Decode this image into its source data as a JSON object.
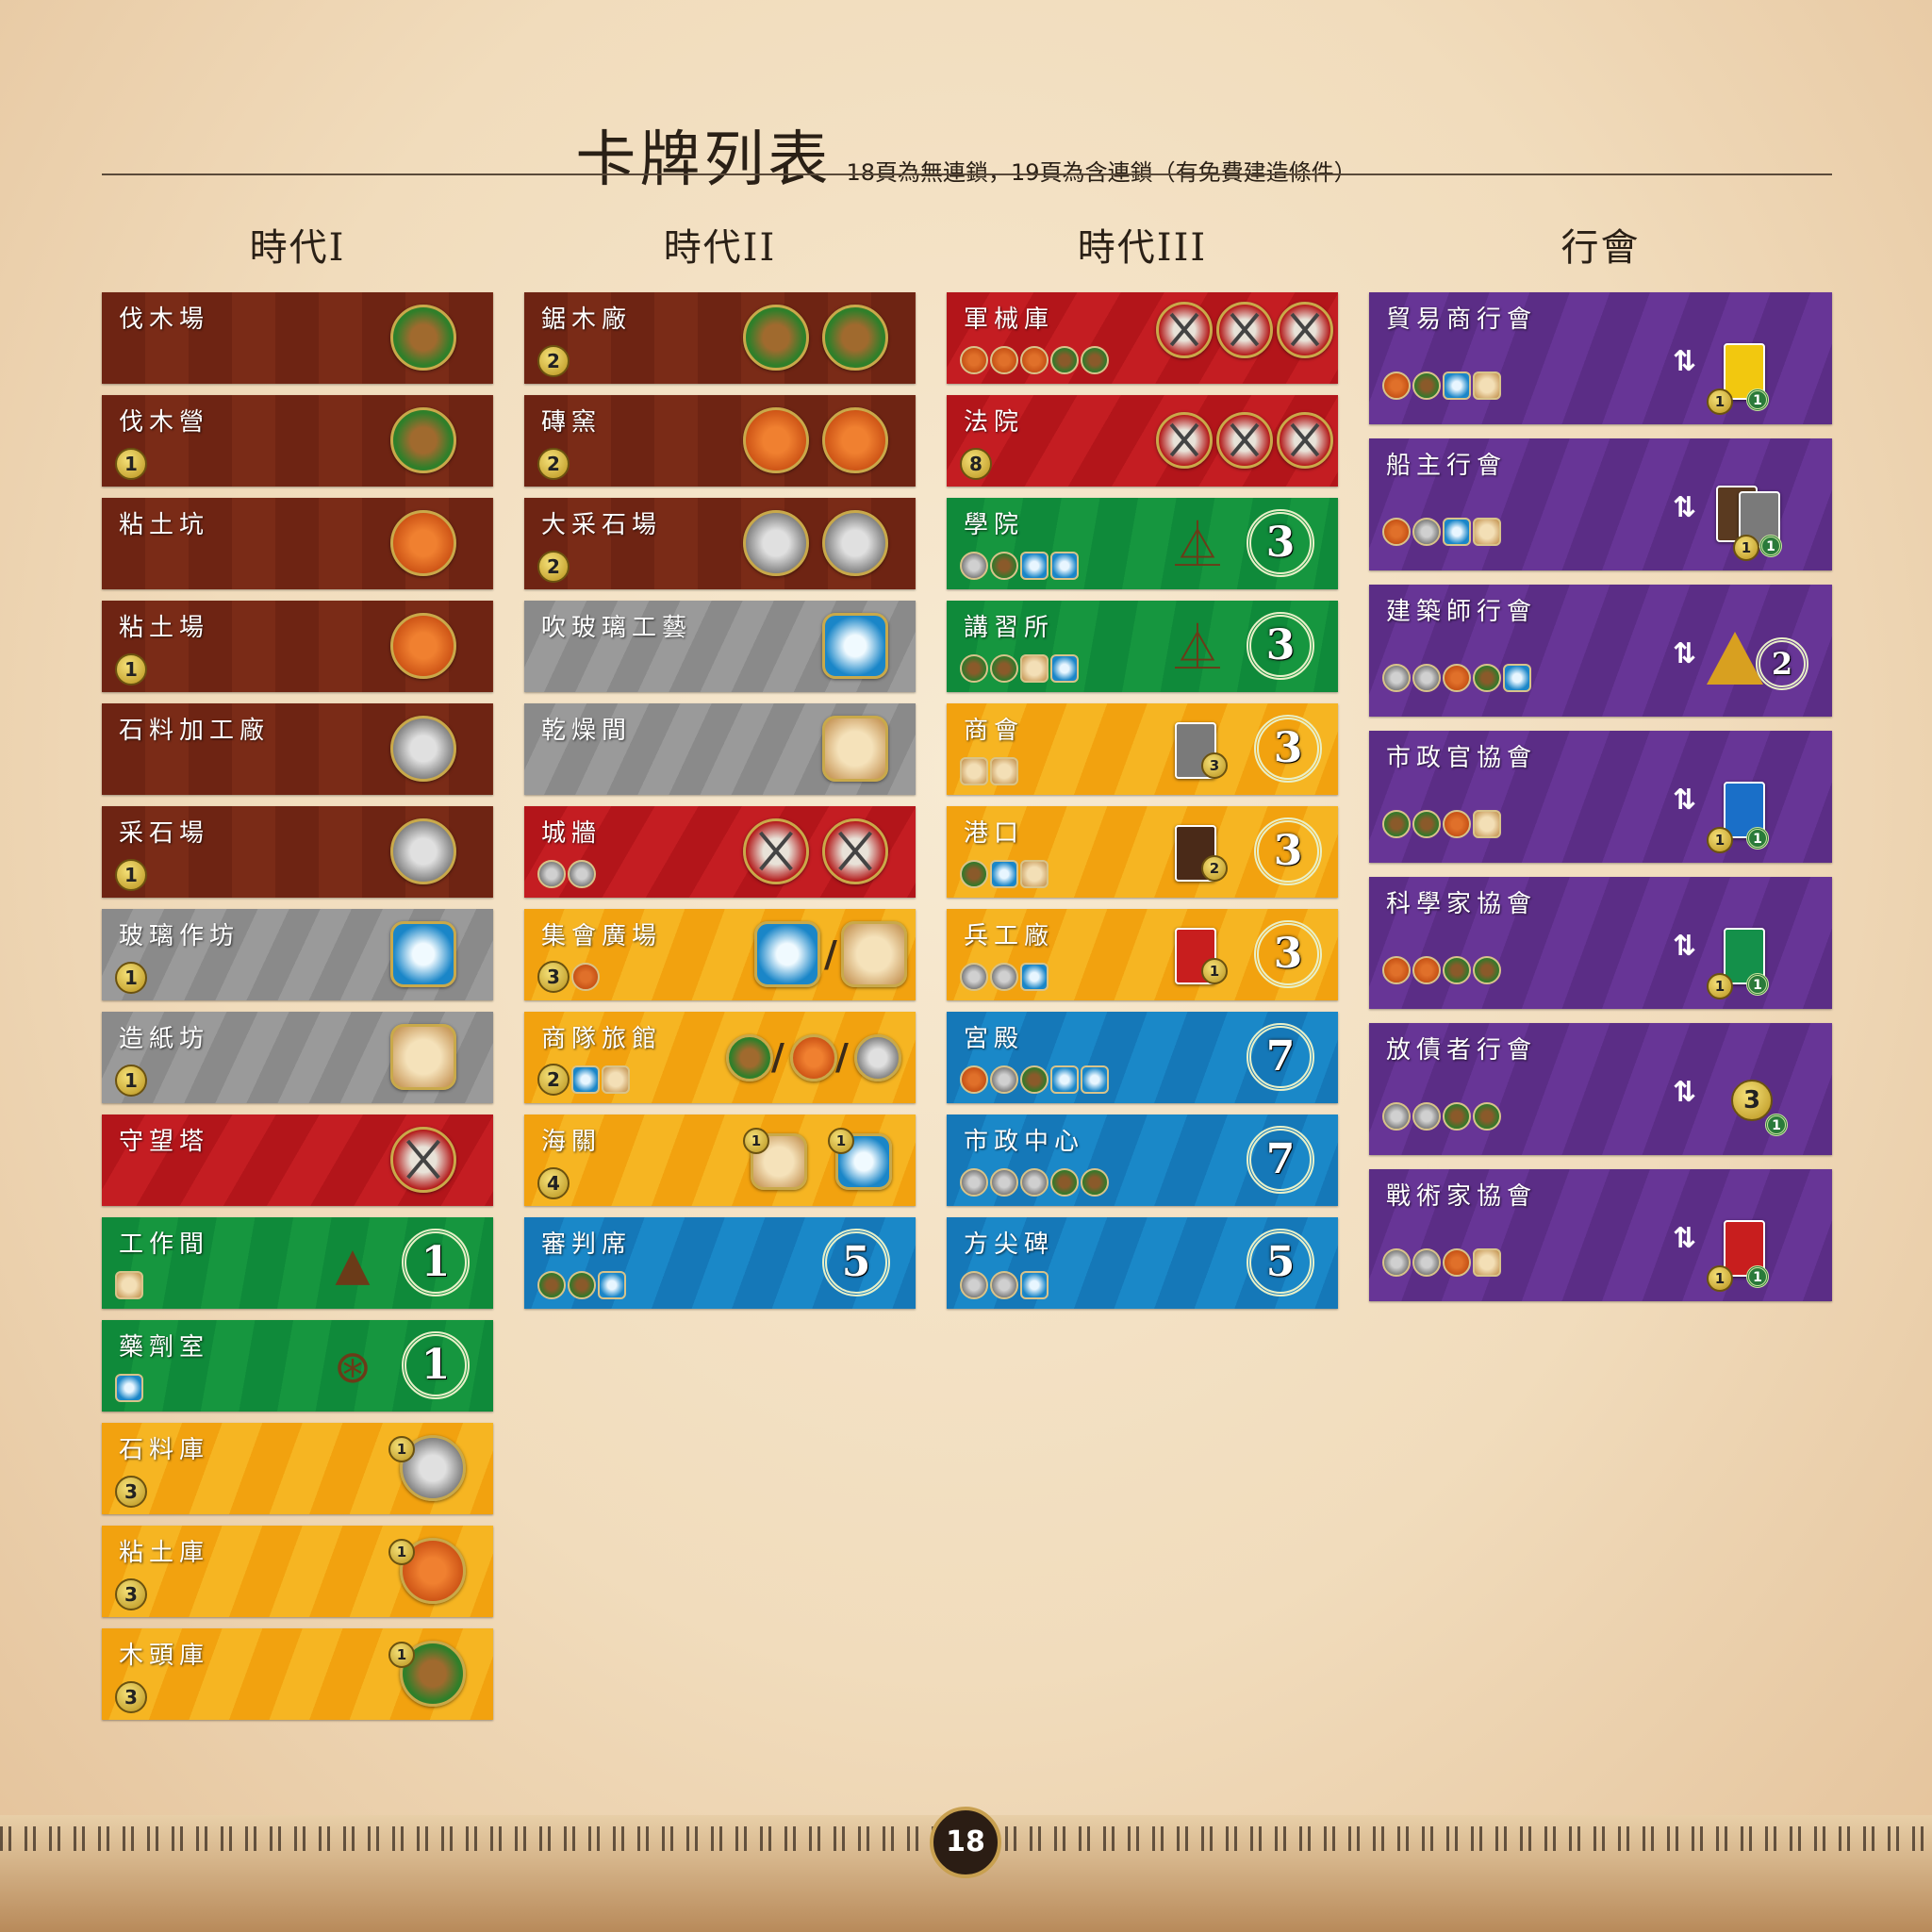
{
  "header": {
    "title": "卡牌列表",
    "subtitle": "18頁為無連鎖，19頁為含連鎖（有免費建造條件）"
  },
  "columns": {
    "age1": {
      "heading": "時代I",
      "cards": [
        {
          "name": "伐木場",
          "color": "brown",
          "cost": ""
        },
        {
          "name": "伐木營",
          "color": "brown",
          "cost": "1"
        },
        {
          "name": "粘土坑",
          "color": "brown",
          "cost": ""
        },
        {
          "name": "粘土場",
          "color": "brown",
          "cost": "1"
        },
        {
          "name": "石料加工廠",
          "color": "brown",
          "cost": ""
        },
        {
          "name": "采石場",
          "color": "brown",
          "cost": "1"
        },
        {
          "name": "玻璃作坊",
          "color": "gray",
          "cost": "1"
        },
        {
          "name": "造紙坊",
          "color": "gray",
          "cost": "1"
        },
        {
          "name": "守望塔",
          "color": "red",
          "cost": ""
        },
        {
          "name": "工作間",
          "color": "green",
          "cost": "",
          "points": "1"
        },
        {
          "name": "藥劑室",
          "color": "green",
          "cost": "",
          "points": "1"
        },
        {
          "name": "石料庫",
          "color": "yellow",
          "cost": "3",
          "trade": "1"
        },
        {
          "name": "粘土庫",
          "color": "yellow",
          "cost": "3",
          "trade": "1"
        },
        {
          "name": "木頭庫",
          "color": "yellow",
          "cost": "3",
          "trade": "1"
        }
      ]
    },
    "age2": {
      "heading": "時代II",
      "cards": [
        {
          "name": "鋸木廠",
          "color": "brown",
          "cost": "2"
        },
        {
          "name": "磚窯",
          "color": "brown",
          "cost": "2"
        },
        {
          "name": "大采石場",
          "color": "brown",
          "cost": "2"
        },
        {
          "name": "吹玻璃工藝",
          "color": "gray",
          "cost": ""
        },
        {
          "name": "乾燥間",
          "color": "gray",
          "cost": ""
        },
        {
          "name": "城牆",
          "color": "red",
          "cost": ""
        },
        {
          "name": "集會廣場",
          "color": "yellow",
          "cost": "3"
        },
        {
          "name": "商隊旅館",
          "color": "yellow",
          "cost": "2"
        },
        {
          "name": "海關",
          "color": "yellow",
          "cost": "4",
          "trade_a": "1",
          "trade_b": "1"
        },
        {
          "name": "審判席",
          "color": "blue",
          "cost": "",
          "points": "5"
        }
      ]
    },
    "age3": {
      "heading": "時代III",
      "cards": [
        {
          "name": "軍械庫",
          "color": "red",
          "cost": ""
        },
        {
          "name": "法院",
          "color": "red",
          "cost": "8"
        },
        {
          "name": "學院",
          "color": "green",
          "cost": "",
          "points": "3"
        },
        {
          "name": "講習所",
          "color": "green",
          "cost": "",
          "points": "3"
        },
        {
          "name": "商會",
          "color": "yellow",
          "cost": "",
          "points": "3",
          "coin": "3"
        },
        {
          "name": "港口",
          "color": "yellow",
          "cost": "",
          "points": "3",
          "coin": "2"
        },
        {
          "name": "兵工廠",
          "color": "yellow",
          "cost": "",
          "points": "3",
          "coin": "1"
        },
        {
          "name": "宮殿",
          "color": "blue",
          "cost": "",
          "points": "7"
        },
        {
          "name": "市政中心",
          "color": "blue",
          "cost": "",
          "points": "7"
        },
        {
          "name": "方尖碑",
          "color": "blue",
          "cost": "",
          "points": "5"
        }
      ]
    },
    "guilds": {
      "heading": "行會",
      "cards": [
        {
          "name": "貿易商行會",
          "coin": "1",
          "vp": "1",
          "card_color": "#f2c80f"
        },
        {
          "name": "船主行會",
          "coin": "1",
          "vp": "1",
          "card_color": "#5a3a20"
        },
        {
          "name": "建築師行會",
          "coin": "",
          "vp": "2",
          "card_color": ""
        },
        {
          "name": "市政官協會",
          "coin": "1",
          "vp": "1",
          "card_color": "#1a6fc8"
        },
        {
          "name": "科學家協會",
          "coin": "1",
          "vp": "1",
          "card_color": "#14904a"
        },
        {
          "name": "放債者行會",
          "coin": "3",
          "vp": "1",
          "card_color": ""
        },
        {
          "name": "戰術家協會",
          "coin": "1",
          "vp": "1",
          "card_color": "#c81e1e"
        }
      ]
    }
  },
  "footer": {
    "page_number": "18"
  },
  "colors": {
    "brown": "#742816",
    "gray": "#929292",
    "red": "#bb181d",
    "green": "#129140",
    "yellow": "#f4aa18",
    "blue": "#1780c0",
    "purple": "#603090"
  }
}
